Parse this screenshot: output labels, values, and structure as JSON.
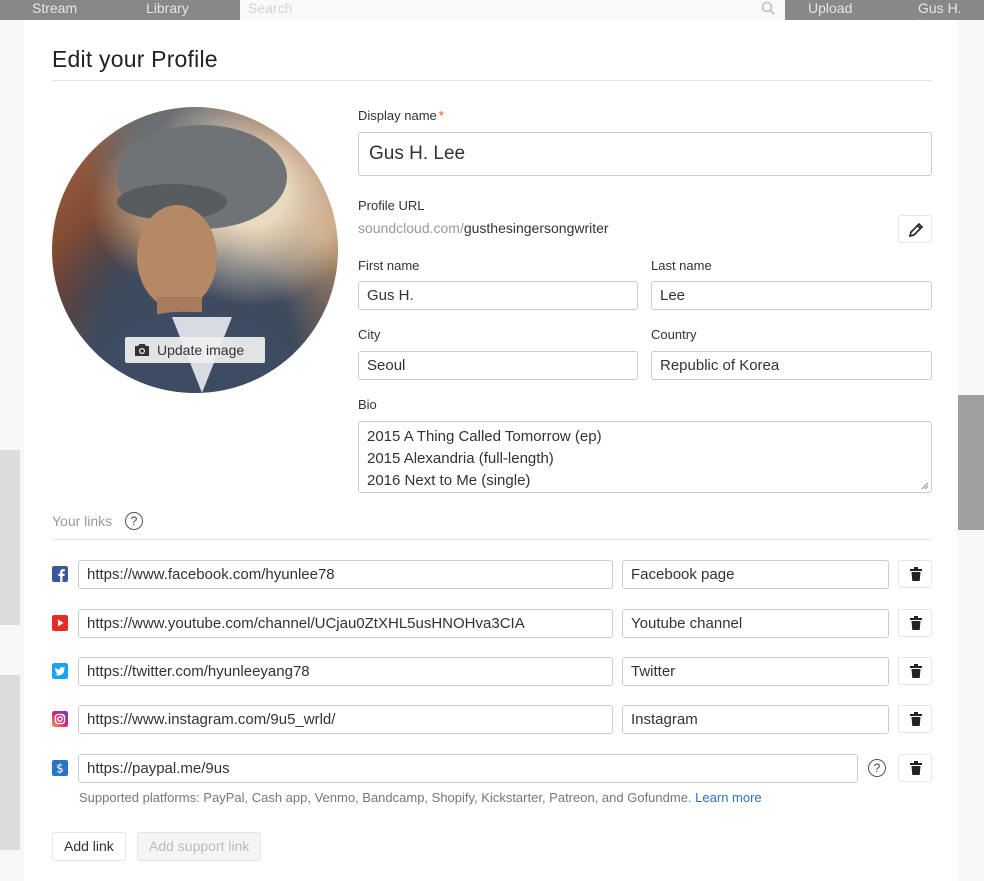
{
  "topbar": {
    "stream": "Stream",
    "library": "Library",
    "search_placeholder": "Search",
    "upload": "Upload",
    "user": "Gus H. Lee"
  },
  "modal": {
    "title": "Edit your Profile",
    "update_image": "Update image",
    "display_name_label": "Display name",
    "required_mark": "*",
    "display_name_value": "Gus H. Lee",
    "profile_url_label": "Profile URL",
    "profile_url_prefix": "soundcloud.com/",
    "profile_url_slug": "gusthesingersongwriter",
    "first_name_label": "First name",
    "first_name_value": "Gus H.",
    "last_name_label": "Last name",
    "last_name_value": "Lee",
    "city_label": "City",
    "city_value": "Seoul",
    "country_label": "Country",
    "country_value": "Republic of Korea",
    "bio_label": "Bio",
    "bio_lines": [
      "2015 A Thing Called Tomorrow (ep)",
      "2015 Alexandria (full-length)",
      "2016 Next to Me (single)"
    ],
    "links_heading": "Your links",
    "help_glyph": "?",
    "links": [
      {
        "icon": "facebook-icon",
        "color": "#3b5998",
        "url": "https://www.facebook.com/hyunlee78",
        "title": "Facebook page"
      },
      {
        "icon": "youtube-icon",
        "color": "#e52d27",
        "url": "https://www.youtube.com/channel/UCjau0ZtXHL5usHNOHva3CIA",
        "title": "Youtube channel"
      },
      {
        "icon": "twitter-icon",
        "color": "#1da1f2",
        "url": "https://twitter.com/hyunleeyang78",
        "title": "Twitter"
      },
      {
        "icon": "instagram-icon",
        "color": "#c13584",
        "url": "https://www.instagram.com/9u5_wrld/",
        "title": "Instagram"
      }
    ],
    "support_link": {
      "icon": "dollar-icon",
      "color": "#2a74c4",
      "url": "https://paypal.me/9us"
    },
    "supported_text": "Supported platforms: PayPal, Cash app, Venmo, Bandcamp, Shopify, Kickstarter, Patreon, and Gofundme.",
    "learn_more": "Learn more",
    "add_link": "Add link",
    "add_support_link": "Add support link"
  }
}
